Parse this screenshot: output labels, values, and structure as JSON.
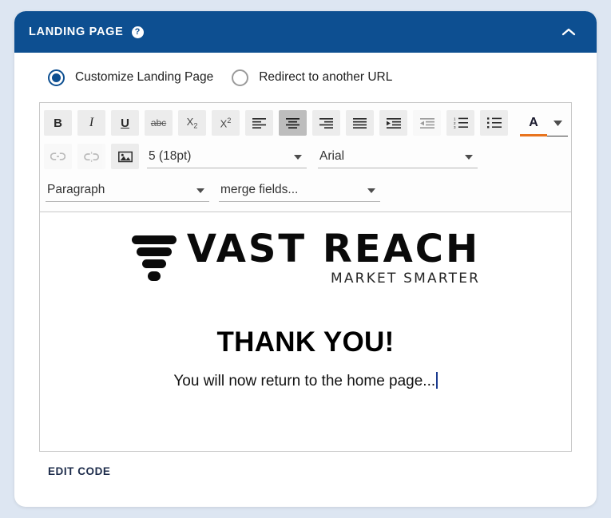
{
  "header": {
    "title": "LANDING PAGE",
    "help_icon": "question-mark-circle-icon",
    "help_glyph": "?",
    "collapse_icon": "chevron-up-icon",
    "bg_color": "#0d4f91"
  },
  "options": {
    "items": [
      {
        "label": "Customize Landing Page",
        "selected": true
      },
      {
        "label": "Redirect to another URL",
        "selected": false
      }
    ]
  },
  "toolbar": {
    "row1": [
      {
        "name": "bold-button",
        "label": "B",
        "state": "normal"
      },
      {
        "name": "italic-button",
        "label": "I",
        "state": "normal"
      },
      {
        "name": "underline-button",
        "label": "U",
        "state": "normal"
      },
      {
        "name": "strikethrough-button",
        "label": "abc",
        "state": "normal"
      },
      {
        "name": "subscript-button",
        "label": "X2",
        "state": "normal"
      },
      {
        "name": "superscript-button",
        "label": "X2",
        "state": "normal"
      },
      {
        "name": "align-left-button",
        "label": "align left",
        "state": "normal"
      },
      {
        "name": "align-center-button",
        "label": "align center",
        "state": "active"
      },
      {
        "name": "align-right-button",
        "label": "align right",
        "state": "normal"
      },
      {
        "name": "align-justify-button",
        "label": "justify",
        "state": "normal"
      },
      {
        "name": "indent-button",
        "label": "indent",
        "state": "normal"
      },
      {
        "name": "outdent-button",
        "label": "outdent",
        "state": "disabled"
      },
      {
        "name": "numbered-list-button",
        "label": "numbered list",
        "state": "normal"
      },
      {
        "name": "bullet-list-button",
        "label": "bullet list",
        "state": "normal"
      }
    ],
    "font_color": {
      "glyph": "A",
      "swatch_color": "#e8741e",
      "caret_icon": "caret-down-icon"
    },
    "row2": [
      {
        "name": "insert-link-button",
        "label": "link",
        "state": "disabled"
      },
      {
        "name": "remove-link-button",
        "label": "unlink",
        "state": "disabled"
      },
      {
        "name": "insert-image-button",
        "label": "image",
        "state": "normal"
      }
    ],
    "font_size": {
      "value": "5 (18pt)"
    },
    "font_family": {
      "value": "Arial"
    },
    "paragraph_style": {
      "value": "Paragraph"
    },
    "merge_fields": {
      "value": "merge fields..."
    }
  },
  "content": {
    "logo": {
      "mark": "funnel-icon",
      "wordmark": "VAST REACH",
      "tagline": "MARKET SMARTER"
    },
    "heading": "THANK YOU!",
    "paragraph": "You will now return to the home page..."
  },
  "footer": {
    "edit_code_label": "EDIT CODE"
  }
}
